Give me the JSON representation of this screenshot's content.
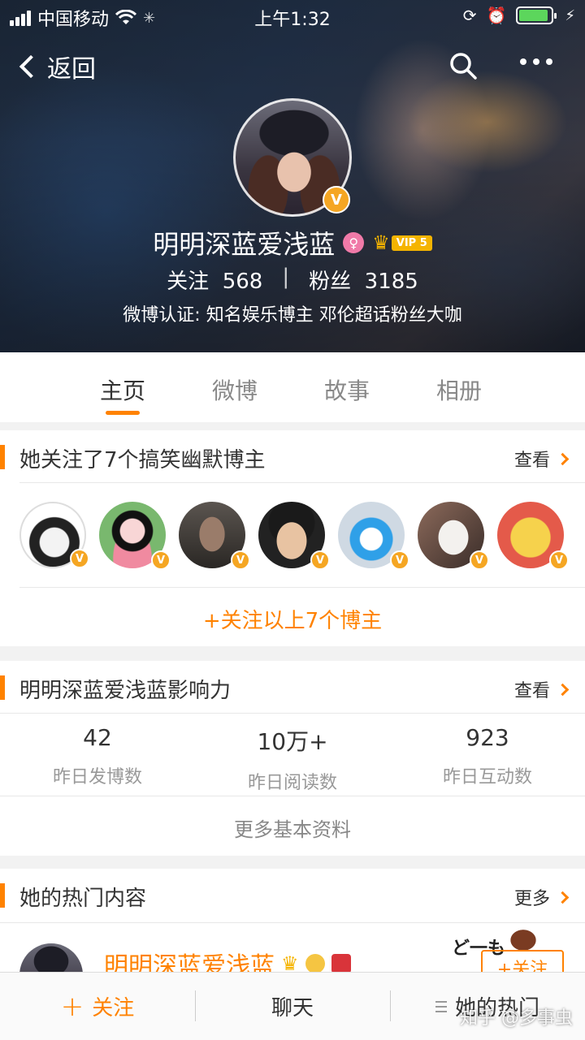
{
  "status_bar": {
    "carrier": "中国移动",
    "time": "上午1:32",
    "battery_level": 0.9
  },
  "nav": {
    "back_label": "返回"
  },
  "profile": {
    "name": "明明深蓝爱浅蓝",
    "verified_badge": "V",
    "gender_symbol": "♀",
    "vip_label": "VIP 5",
    "following_label": "关注",
    "following_count": "568",
    "followers_label": "粉丝",
    "followers_count": "3185",
    "verification": "微博认证: 知名娱乐博主 邓伦超话粉丝大咖"
  },
  "tabs": [
    {
      "label": "主页",
      "active": true
    },
    {
      "label": "微博",
      "active": false
    },
    {
      "label": "故事",
      "active": false
    },
    {
      "label": "相册",
      "active": false
    }
  ],
  "following_card": {
    "title": "她关注了7个搞笑幽默博主",
    "more_label": "查看",
    "follow_all_label": "+关注以上7个博主"
  },
  "influence_card": {
    "title": "明明深蓝爱浅蓝影响力",
    "more_label": "查看",
    "stats": [
      {
        "value": "42",
        "label": "昨日发博数"
      },
      {
        "value": "10万+",
        "label": "昨日阅读数"
      },
      {
        "value": "923",
        "label": "昨日互动数"
      }
    ],
    "more_info_label": "更多基本资料"
  },
  "hot_card": {
    "title": "她的热门内容",
    "more_label": "更多",
    "author_name": "明明深蓝爱浅蓝",
    "follow_label": "+关注",
    "sticker_text": "ど一も"
  },
  "bottom_bar": {
    "follow_label": "关注",
    "chat_label": "聊天",
    "hot_label": "她的热门"
  },
  "watermark": "知乎 @多事虫",
  "colors": {
    "accent": "#ff8200",
    "verified": "#f5a623",
    "vip": "#f5b400"
  }
}
